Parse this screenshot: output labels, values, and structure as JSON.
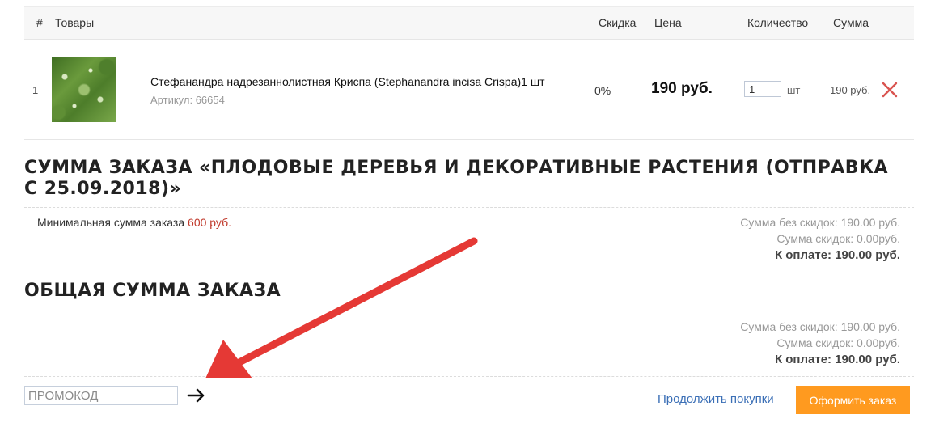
{
  "table": {
    "headers": {
      "num": "#",
      "products": "Товары",
      "discount": "Скидка",
      "price": "Цена",
      "quantity": "Количество",
      "sum": "Сумма"
    },
    "rows": [
      {
        "num": "1",
        "name": "Стефанандра надрезаннолистная Криспа (Stephanandra incisa Crispa)1 шт",
        "sku": "Артикул: 66654",
        "discount": "0%",
        "price": "190 руб.",
        "quantity": "1",
        "unit": "шт",
        "sum": "190 руб."
      }
    ]
  },
  "order_section": {
    "title": "Сумма заказа «Плодовые деревья и декоративные растения (отправка с 25.09.2018)»",
    "min_label": "Минимальная сумма заказа",
    "min_value": "600 руб.",
    "sum_no_discount": "Сумма без скидок: 190.00 руб.",
    "sum_discount": "Сумма скидок: 0.00руб.",
    "to_pay": "К оплате: 190.00 руб."
  },
  "total_section": {
    "title": "Общая сумма заказа",
    "sum_no_discount": "Сумма без скидок: 190.00 руб.",
    "sum_discount": "Сумма скидок: 0.00руб.",
    "to_pay": "К оплате: 190.00 руб."
  },
  "footer": {
    "promo_placeholder": "ПРОМОКОД",
    "continue_label": "Продолжить покупки",
    "order_button": "Оформить заказ"
  },
  "colors": {
    "accent": "#ff9a1f",
    "link": "#3b6fb6",
    "min_value": "#c0392b",
    "remove_icon": "#d9534f",
    "annotation_arrow": "#e53935"
  },
  "icons": {
    "remove": "close-icon",
    "promo_submit": "arrow-right-icon",
    "annotation": "red-arrow-annotation"
  }
}
